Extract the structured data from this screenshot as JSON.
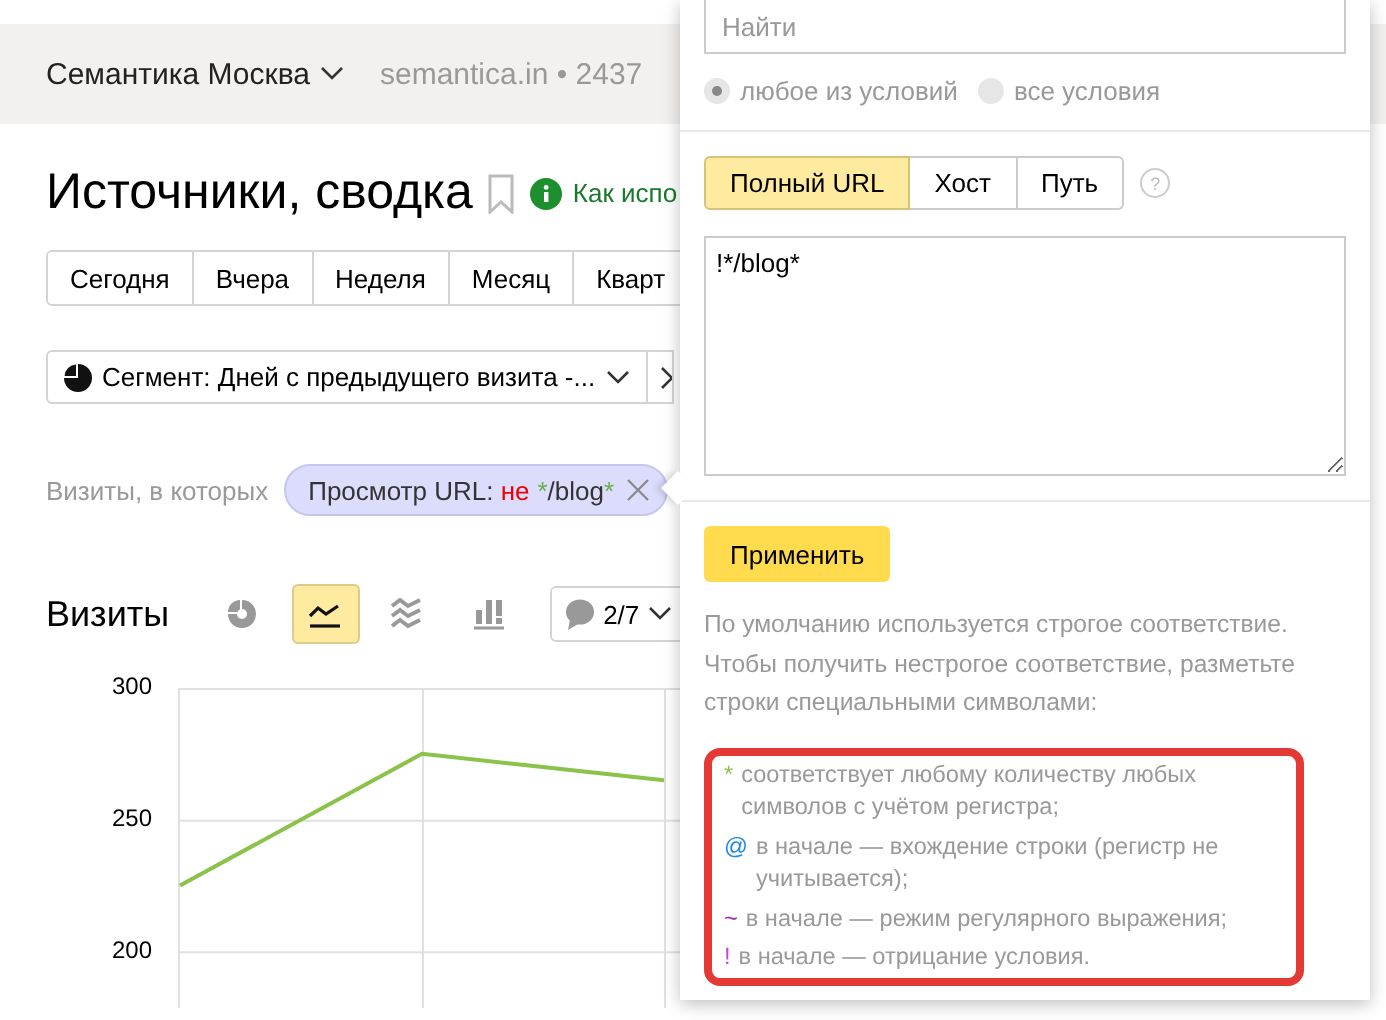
{
  "header": {
    "counter": "Семантика Москва",
    "site": "semantica.in • 2437"
  },
  "report": {
    "title": "Источники, сводка",
    "help_link": "Как испо"
  },
  "periods": [
    {
      "label": "Сегодня",
      "selected": false
    },
    {
      "label": "Вчера",
      "selected": false
    },
    {
      "label": "Неделя",
      "selected": false
    },
    {
      "label": "Месяц",
      "selected": false
    },
    {
      "label": "Кварт",
      "selected": false
    }
  ],
  "segment": {
    "label": "Сегмент: Дней с предыдущего визита -..."
  },
  "filter": {
    "label": "Визиты, в которых",
    "chip": [
      {
        "text": "Просмотр URL: ",
        "kind": "plain"
      },
      {
        "text": "не",
        "kind": "negation"
      },
      {
        "text": "*",
        "kind": "wildcard"
      },
      {
        "text": "/blog",
        "kind": "plain"
      },
      {
        "text": "*",
        "kind": "wildcard"
      }
    ]
  },
  "chart_toolbar": {
    "title": "Визиты",
    "types": [
      {
        "kind": "pie",
        "selected": false
      },
      {
        "kind": "line",
        "selected": true
      },
      {
        "kind": "area",
        "selected": false
      },
      {
        "kind": "bar",
        "selected": false
      }
    ],
    "comments": "2/7"
  },
  "chart_data": {
    "type": "line",
    "grid": true,
    "yticks": [
      200,
      250,
      300
    ],
    "ylim": [
      180,
      300
    ],
    "series": [
      {
        "color": "#8bc34a",
        "values": [
          225,
          275,
          265
        ]
      }
    ]
  },
  "popup": {
    "search": {
      "placeholder": "Найти"
    },
    "conditions": [
      {
        "label": "любое из условий",
        "selected": true
      },
      {
        "label": "все условия",
        "selected": false
      }
    ],
    "url_parts": [
      {
        "label": "Полный URL",
        "selected": true
      },
      {
        "label": "Хост",
        "selected": false
      },
      {
        "label": "Путь",
        "selected": false
      }
    ],
    "help_icon": "?",
    "value": "!*/blog*",
    "apply": "Применить",
    "hint": "По умолчанию используется строгое соответствие. Чтобы получить нестрогое соответствие, разметьте строки специальными символами:",
    "rules": [
      {
        "symbol": "*",
        "color": "#8bc34a",
        "text": "соответствует любому количеству любых символов с учётом регистра;"
      },
      {
        "symbol": "@",
        "color": "#1e88e5",
        "text": "в начале — вхождение строки (регистр не учитывается);"
      },
      {
        "symbol": "~",
        "color": "#9c27b0",
        "text": "в начале — режим регулярного выражения;"
      },
      {
        "symbol": "!",
        "color": "#c940e0",
        "text": "в начале — отрицание условия."
      }
    ]
  }
}
